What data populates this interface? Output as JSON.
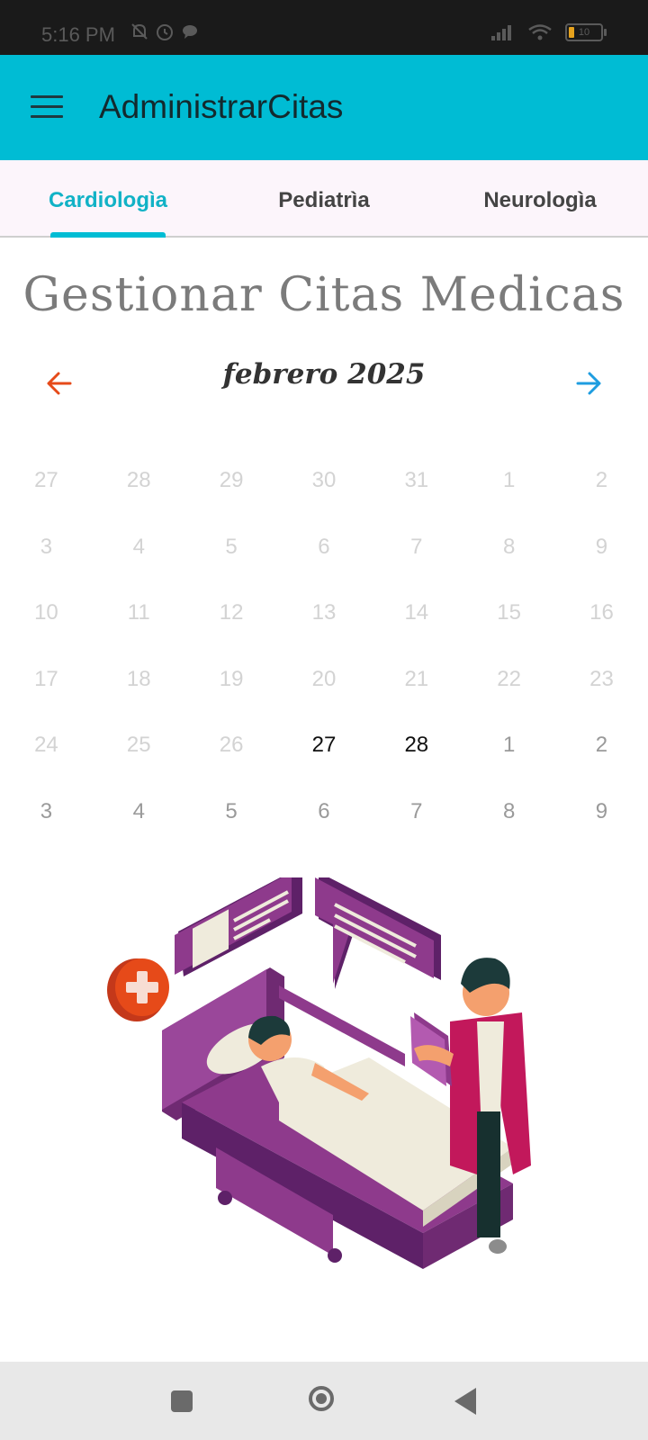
{
  "status_bar": {
    "time": "5:16 PM",
    "battery_level": "10",
    "icons": [
      "mute-icon",
      "alarm-icon",
      "chat-icon",
      "signal-icon",
      "wifi-icon",
      "battery-icon"
    ]
  },
  "app_bar": {
    "title": "AdministrarCitas",
    "menu_icon": "hamburger-menu-icon",
    "background": "#00bcd4"
  },
  "tabs": [
    {
      "label": "Cardiologìa",
      "active": true
    },
    {
      "label": "Pediatrìa",
      "active": false
    },
    {
      "label": "Neurologìa",
      "active": false
    }
  ],
  "page_title": "Gestionar Citas Medicas",
  "calendar": {
    "month_label": "febrero 2025",
    "prev_icon": "arrow-left-icon",
    "next_icon": "arrow-right-icon",
    "prev_color": "#e64a19",
    "next_color": "#1e9de0",
    "weeks": [
      [
        {
          "d": "27",
          "s": "disabled"
        },
        {
          "d": "28",
          "s": "disabled"
        },
        {
          "d": "29",
          "s": "disabled"
        },
        {
          "d": "30",
          "s": "disabled"
        },
        {
          "d": "31",
          "s": "disabled"
        },
        {
          "d": "1",
          "s": "disabled"
        },
        {
          "d": "2",
          "s": "disabled"
        }
      ],
      [
        {
          "d": "3",
          "s": "disabled"
        },
        {
          "d": "4",
          "s": "disabled"
        },
        {
          "d": "5",
          "s": "disabled"
        },
        {
          "d": "6",
          "s": "disabled"
        },
        {
          "d": "7",
          "s": "disabled"
        },
        {
          "d": "8",
          "s": "disabled"
        },
        {
          "d": "9",
          "s": "disabled"
        }
      ],
      [
        {
          "d": "10",
          "s": "disabled"
        },
        {
          "d": "11",
          "s": "disabled"
        },
        {
          "d": "12",
          "s": "disabled"
        },
        {
          "d": "13",
          "s": "disabled"
        },
        {
          "d": "14",
          "s": "disabled"
        },
        {
          "d": "15",
          "s": "disabled"
        },
        {
          "d": "16",
          "s": "disabled"
        }
      ],
      [
        {
          "d": "17",
          "s": "disabled"
        },
        {
          "d": "18",
          "s": "disabled"
        },
        {
          "d": "19",
          "s": "disabled"
        },
        {
          "d": "20",
          "s": "disabled"
        },
        {
          "d": "21",
          "s": "disabled"
        },
        {
          "d": "22",
          "s": "disabled"
        },
        {
          "d": "23",
          "s": "disabled"
        }
      ],
      [
        {
          "d": "24",
          "s": "disabled"
        },
        {
          "d": "25",
          "s": "disabled"
        },
        {
          "d": "26",
          "s": "disabled"
        },
        {
          "d": "27",
          "s": "enabled"
        },
        {
          "d": "28",
          "s": "enabled"
        },
        {
          "d": "1",
          "s": "next-month"
        },
        {
          "d": "2",
          "s": "next-month"
        }
      ],
      [
        {
          "d": "3",
          "s": "next-month"
        },
        {
          "d": "4",
          "s": "next-month"
        },
        {
          "d": "5",
          "s": "next-month"
        },
        {
          "d": "6",
          "s": "next-month"
        },
        {
          "d": "7",
          "s": "next-month"
        },
        {
          "d": "8",
          "s": "next-month"
        },
        {
          "d": "9",
          "s": "next-month"
        }
      ]
    ]
  },
  "illustration": {
    "icon": "hospital-patient-doctor-illustration",
    "colors": {
      "purple": "#8e3a8c",
      "dark_purple": "#5e2168",
      "sheet": "#efebdc",
      "coat": "#c2185b",
      "cross": "#e64a19"
    }
  },
  "system_nav": {
    "icons": [
      "recents-icon",
      "home-icon",
      "back-icon"
    ]
  }
}
